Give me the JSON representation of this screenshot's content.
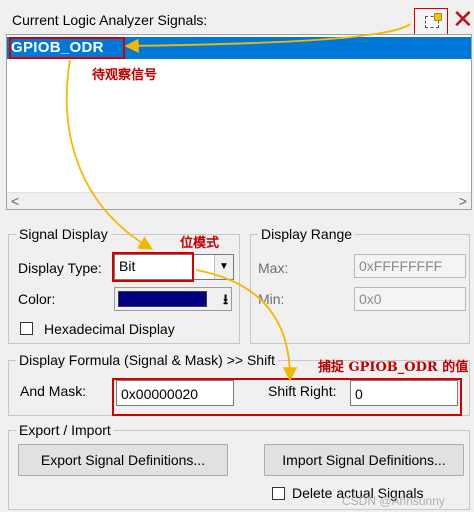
{
  "header": {
    "title": "Current Logic Analyzer Signals:",
    "new_icon": "new-signal-icon",
    "delete_icon": "delete-signal-icon",
    "delete_glyph": "✕"
  },
  "signals": {
    "items": [
      {
        "label": "GPIOB_ODR",
        "selected": true
      }
    ],
    "scroll_left": "<",
    "scroll_right": ">"
  },
  "signal_display": {
    "legend": "Signal Display",
    "display_type_label": "Display Type:",
    "display_type_value": "Bit",
    "color_label": "Color:",
    "color_value": "#000080",
    "hex_label": "Hexadecimal Display",
    "hex_checked": false
  },
  "display_range": {
    "legend": "Display Range",
    "max_label": "Max:",
    "max_value": "0xFFFFFFFF",
    "min_label": "Min:",
    "min_value": "0x0"
  },
  "formula": {
    "legend": "Display Formula (Signal & Mask) >> Shift",
    "and_mask_label": "And Mask:",
    "and_mask_value": "0x00000020",
    "shift_right_label": "Shift Right:",
    "shift_right_value": "0"
  },
  "export_import": {
    "legend": "Export / Import",
    "export_button": "Export Signal Definitions...",
    "import_button": "Import Signal Definitions...",
    "delete_actual_label": "Delete actual Signals",
    "delete_actual_checked": false
  },
  "annotations": {
    "signal_to_watch": "待观察信号",
    "bit_mode": "位模式",
    "capture_value": "捕捉 GPIOB_ODR 的值"
  },
  "watermark": "CSDN @Ahnsunny",
  "colors": {
    "selection": "#0078d7",
    "annotation_red": "#c00000",
    "arrow_orange": "#f5b800"
  }
}
